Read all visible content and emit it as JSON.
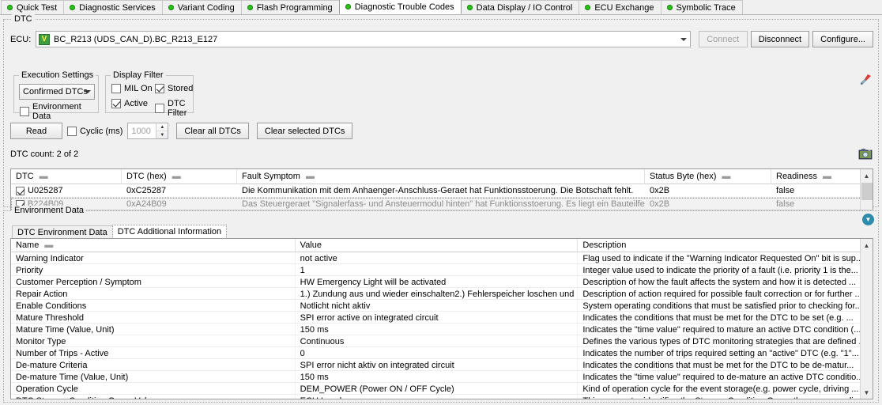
{
  "tabs": [
    {
      "label": "Quick Test",
      "active": false
    },
    {
      "label": "Diagnostic Services",
      "active": false
    },
    {
      "label": "Variant Coding",
      "active": false
    },
    {
      "label": "Flash Programming",
      "active": false
    },
    {
      "label": "Diagnostic Trouble Codes",
      "active": true
    },
    {
      "label": "Data Display / IO Control",
      "active": false
    },
    {
      "label": "ECU Exchange",
      "active": false
    },
    {
      "label": "Symbolic Trace",
      "active": false
    }
  ],
  "dtc_group": {
    "title": "DTC",
    "ecu_label": "ECU:",
    "ecu_badge": "V",
    "ecu_value": "BC_R213 (UDS_CAN_D).BC_R213_E127",
    "connect_label": "Connect",
    "disconnect_label": "Disconnect",
    "configure_label": "Configure..."
  },
  "execution_settings": {
    "title": "Execution Settings",
    "selected": "Confirmed DTCs",
    "environment_data_label": "Environment Data",
    "environment_data_checked": false
  },
  "display_filter": {
    "title": "Display Filter",
    "items": [
      {
        "label": "MIL On",
        "checked": false
      },
      {
        "label": "Stored",
        "checked": true
      },
      {
        "label": "Active",
        "checked": true
      },
      {
        "label": "DTC Filter",
        "checked": false
      }
    ]
  },
  "actions": {
    "read_label": "Read",
    "cyclic_label": "Cyclic (ms)",
    "cyclic_checked": false,
    "cyclic_value": "1000",
    "clear_all_label": "Clear all DTCs",
    "clear_selected_label": "Clear selected DTCs"
  },
  "dtc_count": "DTC count:  2 of 2",
  "dtc_table": {
    "columns": [
      "DTC",
      "DTC (hex)",
      "Fault Symptom",
      "Status Byte (hex)",
      "Readiness"
    ],
    "rows": [
      {
        "checked": true,
        "selected": false,
        "dtc": "U025287",
        "hex": "0xC25287",
        "symptom": "Die Kommunikation mit dem Anhaenger-Anschluss-Geraet hat Funktionsstoerung. Die Botschaft fehlt.",
        "status": "0x2B",
        "readiness": "false"
      },
      {
        "checked": true,
        "selected": true,
        "dtc": "B224B09",
        "hex": "0xA24B09",
        "symptom": "Das Steuergeraet \"Signalerfass- und Ansteuermodul hinten\" hat Funktionsstoerung. Es liegt ein Bauteilfehler vor.",
        "status": "0x2B",
        "readiness": "false"
      }
    ]
  },
  "environment": {
    "title": "Environment Data",
    "subtabs": [
      {
        "label": "DTC Environment Data",
        "active": false
      },
      {
        "label": "DTC Additional Information",
        "active": true
      }
    ],
    "columns": [
      "Name",
      "Value",
      "Description"
    ],
    "rows": [
      {
        "name": "Warning Indicator",
        "value": "not active",
        "description": "Flag used to indicate if the \"Warning Indicator Requested On\" bit is sup..."
      },
      {
        "name": "Priority",
        "value": "1",
        "description": "Integer value used to indicate the priority of a fault (i.e. priority 1 is the..."
      },
      {
        "name": "Customer Perception / Symptom",
        "value": "HW Emergency Light will be activated",
        "description": "Description of how the fault affects the system and how it is detected ..."
      },
      {
        "name": "Repair Action",
        "value": "1.) Zundung aus und wieder einschalten2.) Fehlerspeicher loschen und ...",
        "description": "Description of action required for possible fault correction or for further ..."
      },
      {
        "name": "Enable Conditions",
        "value": "Notlicht nicht aktiv",
        "description": "System operating conditions that must be satisfied prior to checking for..."
      },
      {
        "name": "Mature Threshold",
        "value": "SPI error active on integrated circuit",
        "description": "Indicates the conditions that must be met for the DTC to be set (e.g. ..."
      },
      {
        "name": "Mature Time (Value, Unit)",
        "value": "150 ms",
        "description": "Indicates the \"time value\" required to mature an active DTC condition (..."
      },
      {
        "name": "Monitor Type",
        "value": "Continuous",
        "description": "Defines the various types of DTC monitoring strategies that are defined ..."
      },
      {
        "name": "Number of Trips - Active",
        "value": "0",
        "description": "Indicates the number of trips required setting an \"active\" DTC (e.g. \"1\"..."
      },
      {
        "name": "De-mature Criteria",
        "value": "SPI error nicht aktiv on integrated circuit",
        "description": "Indicates the conditions that must be met for the DTC to be de-matur..."
      },
      {
        "name": "De-mature Time (Value, Unit)",
        "value": "150 ms",
        "description": "Indicates the \"time value\" required to de-mature an active DTC conditio..."
      },
      {
        "name": "Operation Cycle",
        "value": "DEM_POWER (Power ON / OFF Cycle)",
        "description": "Kind of operation cycle for the event storage(e.g. power cycle, driving ..."
      },
      {
        "name": "DTC Storage Condition Group Value",
        "value": "ECU Level",
        "description": "This parameter identifies the Storage Condition Group the correspondin..."
      }
    ]
  },
  "icons": {
    "screwdriver": "screwdriver-icon",
    "camera": "camera-icon",
    "collapse": "chevron-down-circle-icon"
  },
  "colors": {
    "led_green": "#2bbf1c",
    "badge_green": "#3f9e3f",
    "collapse_blue": "#2e8bab"
  }
}
